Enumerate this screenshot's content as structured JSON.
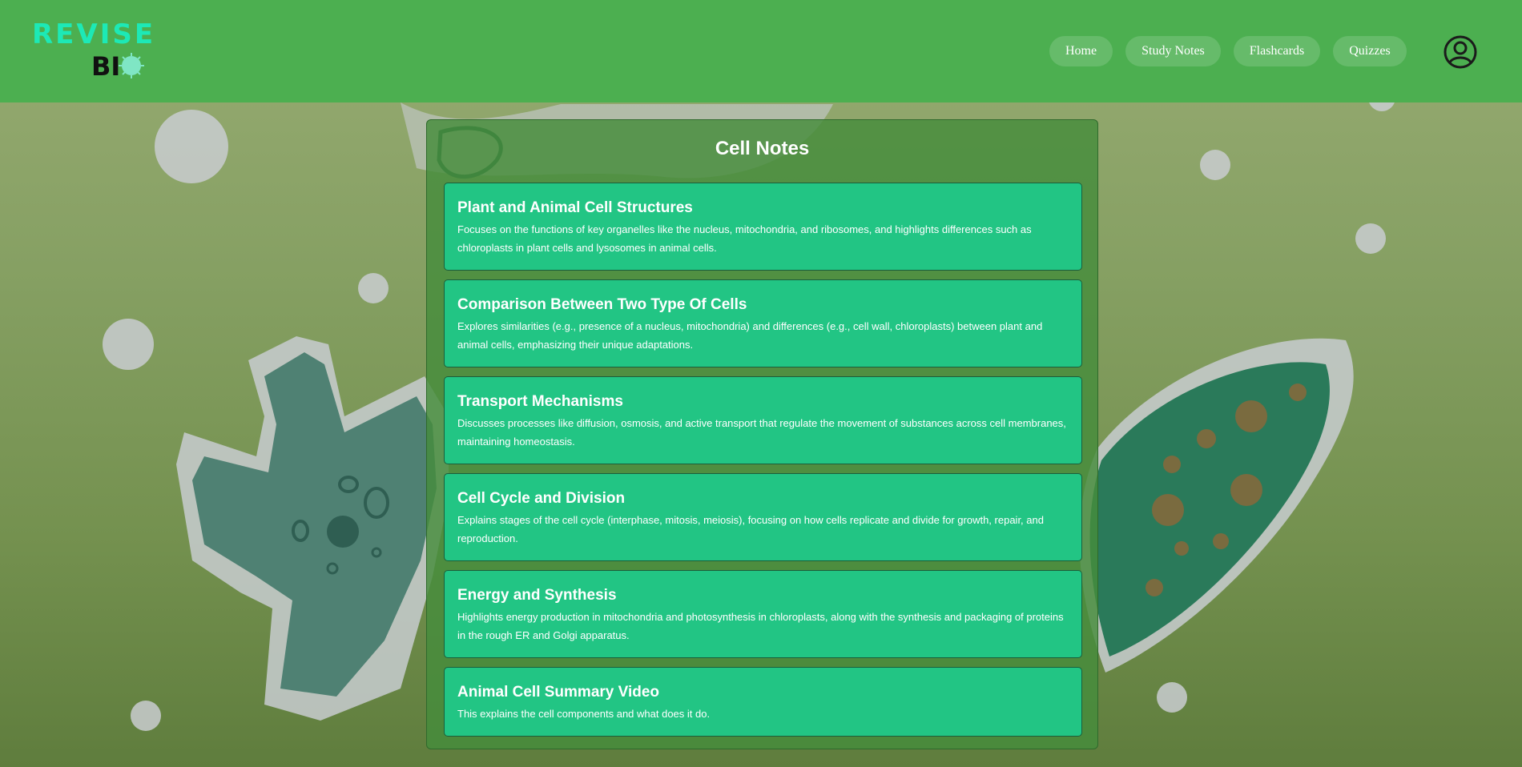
{
  "brand": {
    "logo_top": "REVISE",
    "logo_bottom": "BI",
    "accent": "#1de9b6",
    "header_color": "#4caf50"
  },
  "nav": {
    "items": [
      {
        "label": "Home"
      },
      {
        "label": "Study Notes"
      },
      {
        "label": "Flashcards"
      },
      {
        "label": "Quizzes"
      }
    ],
    "account_icon": "user-circle-icon"
  },
  "panel": {
    "title": "Cell Notes",
    "cards": [
      {
        "title": "Plant and Animal Cell Structures",
        "desc": "Focuses on the functions of key organelles like the nucleus, mitochondria, and ribosomes, and highlights differences such as chloroplasts in plant cells and lysosomes in animal cells."
      },
      {
        "title": "Comparison Between Two Type Of Cells",
        "desc": "Explores similarities (e.g., presence of a nucleus, mitochondria) and differences (e.g., cell wall, chloroplasts) between plant and animal cells, emphasizing their unique adaptations."
      },
      {
        "title": "Transport Mechanisms",
        "desc": "Discusses processes like diffusion, osmosis, and active transport that regulate the movement of substances across cell membranes, maintaining homeostasis."
      },
      {
        "title": "Cell Cycle and Division",
        "desc": "Explains stages of the cell cycle (interphase, mitosis, meiosis), focusing on how cells replicate and divide for growth, repair, and reproduction."
      },
      {
        "title": "Energy and Synthesis",
        "desc": "Highlights energy production in mitochondria and photosynthesis in chloroplasts, along with the synthesis and packaging of proteins in the rough ER and Golgi apparatus."
      },
      {
        "title": "Animal Cell Summary Video",
        "desc": "This explains the cell components and what does it do."
      }
    ]
  }
}
